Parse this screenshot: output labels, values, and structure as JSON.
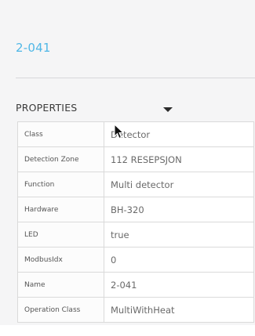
{
  "title": "2-041",
  "properties": {
    "header": "PROPERTIES",
    "toggle_icon": "caret-down-icon",
    "rows": [
      {
        "key": "Class",
        "value": "Detector"
      },
      {
        "key": "Detection Zone",
        "value": "112 RESEPSJON"
      },
      {
        "key": "Function",
        "value": "Multi detector"
      },
      {
        "key": "Hardware",
        "value": "BH-320"
      },
      {
        "key": "LED",
        "value": "true"
      },
      {
        "key": "ModbusIdx",
        "value": "0"
      },
      {
        "key": "Name",
        "value": "2-041"
      },
      {
        "key": "Operation Class",
        "value": "MultiWithHeat"
      }
    ]
  },
  "colors": {
    "title": "#4fb7e6",
    "panel_bg": "#f5f5f6",
    "border": "#dadada"
  }
}
